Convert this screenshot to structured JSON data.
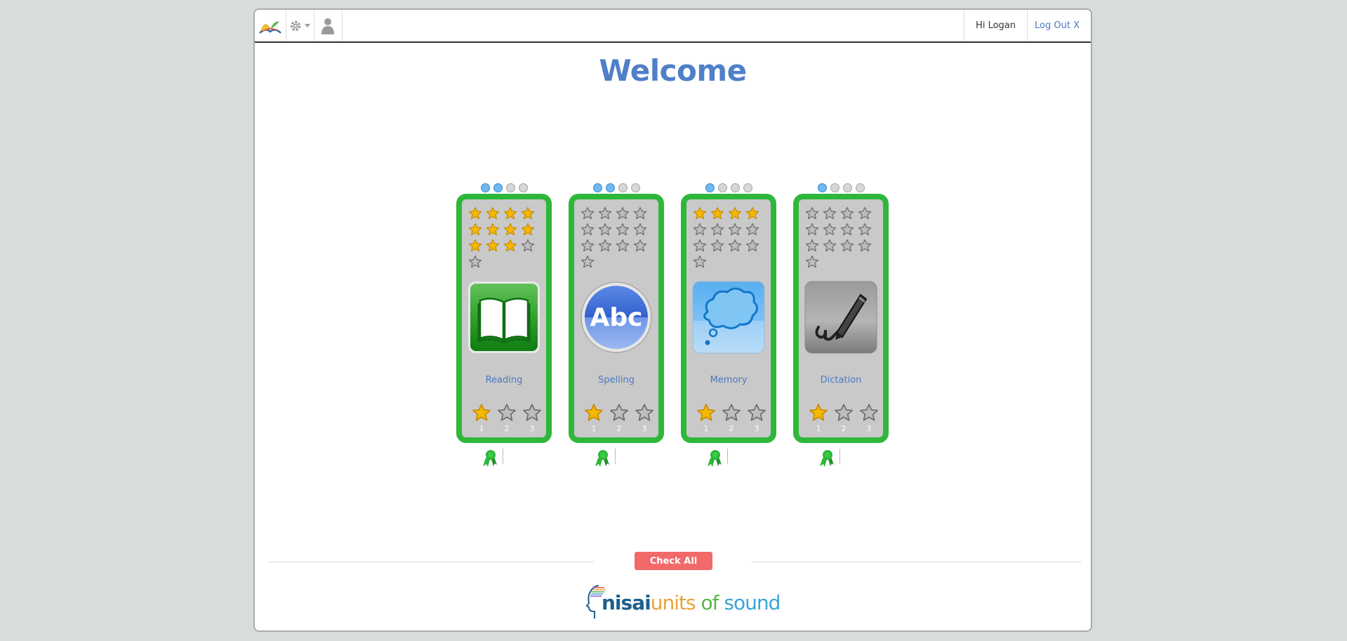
{
  "header": {
    "greeting": "Hi Logan",
    "logout_label": "Log Out X"
  },
  "page": {
    "title": "Welcome"
  },
  "colors": {
    "card_border": "#2fb73a",
    "star_gold": "#f5b800",
    "accent_blue": "#4f7fc8",
    "check_all": "#f2696a"
  },
  "activities": [
    {
      "label": "Reading",
      "icon": "book-icon",
      "progress_dots": [
        true,
        true,
        false,
        false
      ],
      "stars_total": 13,
      "stars_earned": 11,
      "levels": [
        "1",
        "2",
        "3"
      ],
      "levels_earned": 1
    },
    {
      "label": "Spelling",
      "icon": "abc-icon",
      "progress_dots": [
        true,
        true,
        false,
        false
      ],
      "stars_total": 13,
      "stars_earned": 0,
      "levels": [
        "1",
        "2",
        "3"
      ],
      "levels_earned": 1
    },
    {
      "label": "Memory",
      "icon": "thought-cloud-icon",
      "progress_dots": [
        true,
        false,
        false,
        false
      ],
      "stars_total": 13,
      "stars_earned": 4,
      "levels": [
        "1",
        "2",
        "3"
      ],
      "levels_earned": 1
    },
    {
      "label": "Dictation",
      "icon": "pen-icon",
      "progress_dots": [
        true,
        false,
        false,
        false
      ],
      "stars_total": 13,
      "stars_earned": 0,
      "levels": [
        "1",
        "2",
        "3"
      ],
      "levels_earned": 1
    }
  ],
  "footer": {
    "check_all_label": "Check All",
    "brand": {
      "nisai": "nisai",
      "units": "units",
      "of": "of",
      "sound": "sound"
    }
  }
}
